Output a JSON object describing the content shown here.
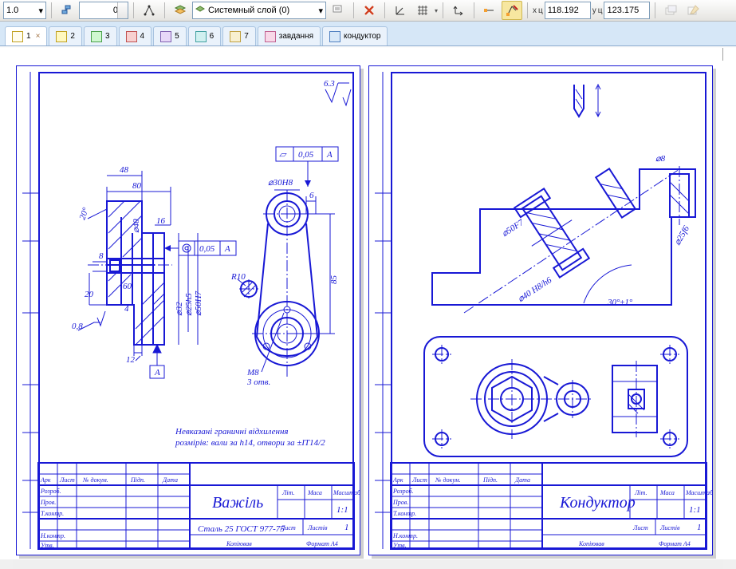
{
  "toolbar": {
    "lineweight": "1.0",
    "step": "0",
    "layer_label": "Системный слой (0)",
    "coord_x_label": "x",
    "coord_y_label": "y",
    "coord_x": "118.192",
    "coord_y": "123.175"
  },
  "tabs": [
    {
      "label": "1",
      "active": true,
      "close": true
    },
    {
      "label": "2"
    },
    {
      "label": "3"
    },
    {
      "label": "4"
    },
    {
      "label": "5"
    },
    {
      "label": "6"
    },
    {
      "label": "7"
    },
    {
      "label": "завдання"
    },
    {
      "label": "кондуктор"
    }
  ],
  "drawing_left": {
    "title": "Важіль",
    "material": "Сталь 25  ГОСТ 977-75",
    "note1": "Невказані граничні відхилення",
    "note2": "розмірів: вали за h14, отвори за ±IT14/2",
    "surface_mark": "6.3",
    "tb_scale": "1:1",
    "tb_sheet": "1",
    "tb_format": "Формат   А4",
    "tb_copied": "Копіював",
    "tb_headers": [
      "Арк",
      "Лист",
      "№ докум.",
      "Підп.",
      "Дата"
    ],
    "tb_rows": [
      "Розроб.",
      "Пров.",
      "Т.контр.",
      "Н.контр.",
      "Утв."
    ],
    "tb_col_labels": [
      "Літ.",
      "Маса",
      "Масштаб",
      "Лист",
      "Листів"
    ],
    "dims": {
      "d80": "80",
      "d48": "48",
      "d20a": "20°",
      "d8": "8",
      "d20": "20",
      "d4": "4",
      "d16": "16",
      "d40": "⌀40",
      "d08": "0,8",
      "d60": "60",
      "d12": "12",
      "d32": "⌀32",
      "d50": "⌀50H7",
      "d25": "⌀25h5",
      "A": "А",
      "R10": "R10",
      "d30": "⌀30H8",
      "M8": "М8",
      "otv": "3 отв.",
      "d6": "6",
      "d85": "85",
      "tol": "0,05",
      "par": "0,05"
    }
  },
  "drawing_right": {
    "title": "Кондуктор",
    "tb_scale": "1:1",
    "tb_sheet": "1",
    "tb_format": "Формат   А4",
    "tb_copied": "Копіював",
    "tb_headers": [
      "Арк",
      "Лист",
      "№ докум.",
      "Підп.",
      "Дата"
    ],
    "tb_rows": [
      "Розроб.",
      "Пров.",
      "Т.контр.",
      "Н.контр.",
      "Утв."
    ],
    "tb_col_labels": [
      "Літ.",
      "Маса",
      "Масштаб",
      "Лист",
      "Листів"
    ],
    "dims": {
      "ang": "30°±1°",
      "d40": "⌀40 H8/h6",
      "d50": "⌀50F7",
      "d25": "⌀25f6",
      "d8": "⌀8"
    }
  }
}
